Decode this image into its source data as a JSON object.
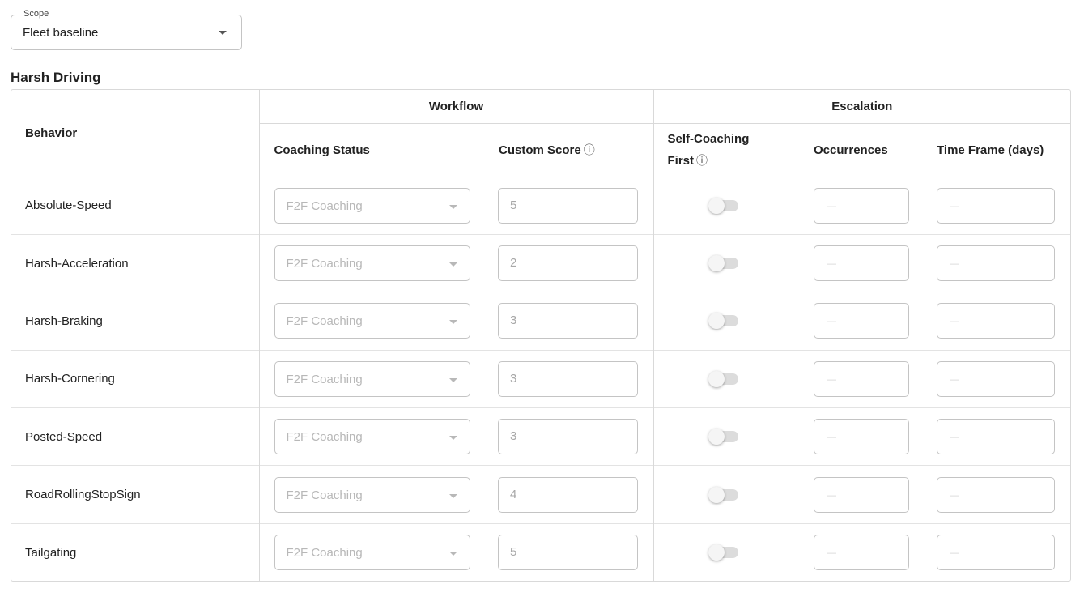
{
  "scope": {
    "label": "Scope",
    "value": "Fleet baseline"
  },
  "section_title": "Harsh Driving",
  "table": {
    "groups": {
      "workflow": "Workflow",
      "escalation": "Escalation"
    },
    "headers": {
      "behavior": "Behavior",
      "coaching_status": "Coaching Status",
      "custom_score": "Custom Score",
      "self_coaching_line1": "Self-Coaching",
      "self_coaching_line2": "First",
      "occurrences": "Occurrences",
      "time_frame": "Time Frame (days)",
      "info_icon": "ⓘ"
    },
    "rows": [
      {
        "behavior": "Absolute-Speed",
        "coaching_status": "F2F Coaching",
        "custom_score": "5",
        "self_coaching_first": false,
        "occurrences": "—",
        "time_frame": "—"
      },
      {
        "behavior": "Harsh-Acceleration",
        "coaching_status": "F2F Coaching",
        "custom_score": "2",
        "self_coaching_first": false,
        "occurrences": "—",
        "time_frame": "—"
      },
      {
        "behavior": "Harsh-Braking",
        "coaching_status": "F2F Coaching",
        "custom_score": "3",
        "self_coaching_first": false,
        "occurrences": "—",
        "time_frame": "—"
      },
      {
        "behavior": "Harsh-Cornering",
        "coaching_status": "F2F Coaching",
        "custom_score": "3",
        "self_coaching_first": false,
        "occurrences": "—",
        "time_frame": "—"
      },
      {
        "behavior": "Posted-Speed",
        "coaching_status": "F2F Coaching",
        "custom_score": "3",
        "self_coaching_first": false,
        "occurrences": "—",
        "time_frame": "—"
      },
      {
        "behavior": "RoadRollingStopSign",
        "coaching_status": "F2F Coaching",
        "custom_score": "4",
        "self_coaching_first": false,
        "occurrences": "—",
        "time_frame": "—"
      },
      {
        "behavior": "Tailgating",
        "coaching_status": "F2F Coaching",
        "custom_score": "5",
        "self_coaching_first": false,
        "occurrences": "—",
        "time_frame": "—"
      }
    ]
  }
}
